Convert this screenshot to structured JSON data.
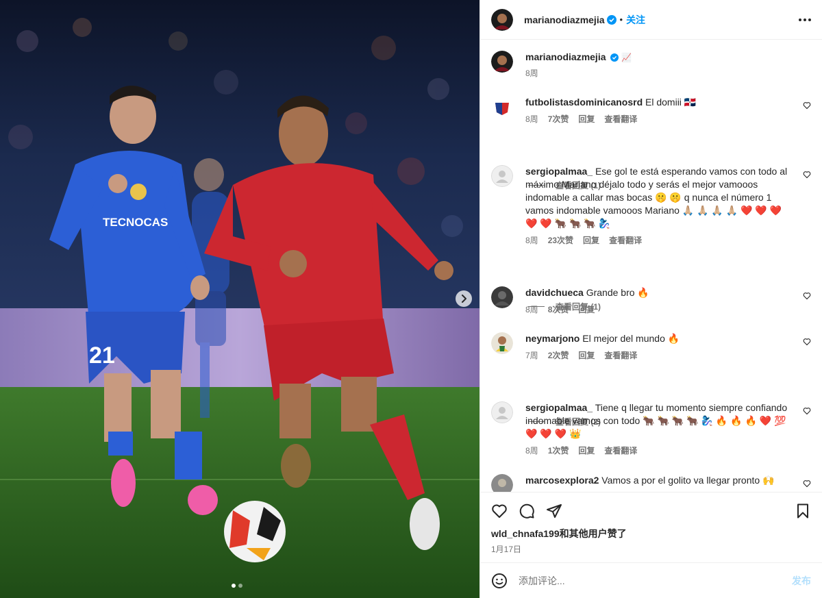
{
  "post": {
    "author": "marianodiazmejia",
    "follow_label": "关注",
    "caption": {
      "username": "marianodiazmejia",
      "text": "📈",
      "time": "8周"
    }
  },
  "comments": [
    {
      "username": "futbolistasdominicanosrd",
      "text": "El domiii 🇩🇴",
      "time": "8周",
      "likes": "7次赞",
      "reply": "回复",
      "translate": "查看翻译",
      "replies": "查看回复 (1)"
    },
    {
      "username": "sergiopalmaa_",
      "text": "Ese gol te está esperando vamos con todo al máximo Mariano déjalo todo y serás el mejor vamooos indomable a callar mas bocas 🤫 🤫 q nunca el número 1 vamos indomable vamooos Mariano 🙏🏼 🙏🏼 🙏🏼 🙏🏼 ❤️ ❤️ ❤️ ❤️ ❤️ 🐂 🐂 🐂 🧞‍♀️",
      "time": "8周",
      "likes": "23次赞",
      "reply": "回复",
      "translate": "查看翻译",
      "replies": "查看回复 (1)"
    },
    {
      "username": "davidchueca",
      "text": "Grande bro 🔥",
      "time": "8周",
      "likes": "8次赞",
      "reply": "回复"
    },
    {
      "username": "neymarjono",
      "text": "El mejor del mundo 🔥",
      "time": "7周",
      "likes": "2次赞",
      "reply": "回复",
      "translate": "查看翻译",
      "replies": "查看回复 (2)"
    },
    {
      "username": "sergiopalmaa_",
      "text": "Tiene q llegar tu momento siempre confiando indomable vamos con todo 🐂 🐂 🐂 🐂 🧞‍♀️ 🔥 🔥 🔥 ❤️ 💯 ❤️ ❤️ ❤️ 👑",
      "time": "8周",
      "likes": "1次赞",
      "reply": "回复",
      "translate": "查看翻译"
    },
    {
      "username": "marcosexplora2",
      "text": "Vamos a por el golito va llegar pronto 🙌"
    }
  ],
  "likes_text": "wld_chnafa199和其他用户赞了",
  "post_date": "1月17日",
  "add_comment": {
    "placeholder": "添加评论...",
    "post_label": "发布"
  },
  "carousel": {
    "current": 1,
    "total": 2
  },
  "colors": {
    "accent": "#0095f6",
    "verified": "#0095f6",
    "post_disabled": "#b2dffc"
  },
  "icons": [
    "verified-badge-icon",
    "more-options-icon",
    "heart-icon",
    "comment-icon",
    "share-icon",
    "bookmark-icon",
    "emoji-icon",
    "chevron-right-icon"
  ]
}
